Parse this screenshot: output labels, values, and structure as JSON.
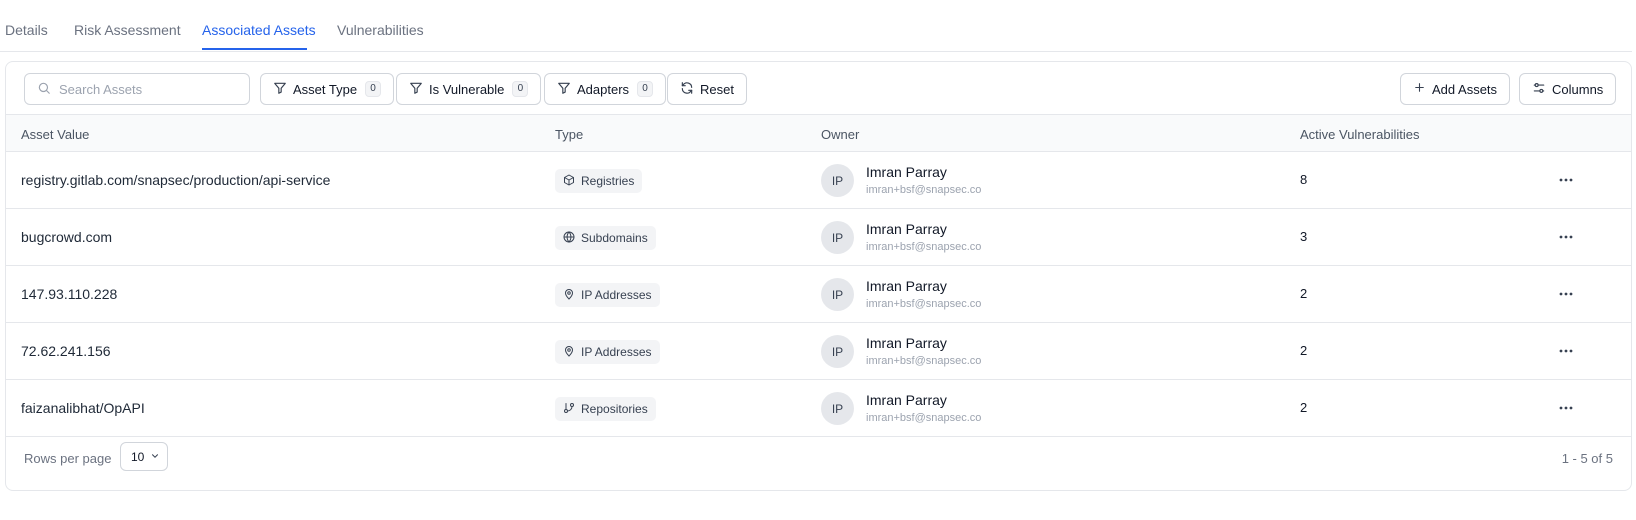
{
  "tabs": [
    {
      "label": "Details"
    },
    {
      "label": "Risk Assessment"
    },
    {
      "label": "Associated Assets"
    },
    {
      "label": "Vulnerabilities"
    }
  ],
  "active_tab": "Associated Assets",
  "accent_color": "#2563eb",
  "toolbar": {
    "search_placeholder": "Search Assets",
    "filters": [
      {
        "label": "Asset Type",
        "count": "0",
        "icon": "filter-icon"
      },
      {
        "label": "Is Vulnerable",
        "count": "0",
        "icon": "filter-icon"
      },
      {
        "label": "Adapters",
        "count": "0",
        "icon": "filter-icon"
      }
    ],
    "reset_label": "Reset",
    "add_assets_label": "Add Assets",
    "columns_label": "Columns"
  },
  "table": {
    "headers": [
      "Asset Value",
      "Type",
      "Owner",
      "Active Vulnerabilities"
    ],
    "rows": [
      {
        "value": "registry.gitlab.com/snapsec/production/api-service",
        "type": "Registries",
        "type_icon": "box-icon",
        "owner_initials": "IP",
        "owner_name": "Imran Parray",
        "owner_email": "imran+bsf@snapsec.co",
        "vulns": "8"
      },
      {
        "value": "bugcrowd.com",
        "type": "Subdomains",
        "type_icon": "globe-icon",
        "owner_initials": "IP",
        "owner_name": "Imran Parray",
        "owner_email": "imran+bsf@snapsec.co",
        "vulns": "3"
      },
      {
        "value": "147.93.110.228",
        "type": "IP Addresses",
        "type_icon": "map-pin-icon",
        "owner_initials": "IP",
        "owner_name": "Imran Parray",
        "owner_email": "imran+bsf@snapsec.co",
        "vulns": "2"
      },
      {
        "value": "72.62.241.156",
        "type": "IP Addresses",
        "type_icon": "map-pin-icon",
        "owner_initials": "IP",
        "owner_name": "Imran Parray",
        "owner_email": "imran+bsf@snapsec.co",
        "vulns": "2"
      },
      {
        "value": "faizanalibhat/OpAPI",
        "type": "Repositories",
        "type_icon": "git-branch-icon",
        "owner_initials": "IP",
        "owner_name": "Imran Parray",
        "owner_email": "imran+bsf@snapsec.co",
        "vulns": "2"
      }
    ]
  },
  "footer": {
    "rows_per_page_label": "Rows per page",
    "rows_per_page_value": "10",
    "pagination_text": "1 - 5 of 5"
  }
}
